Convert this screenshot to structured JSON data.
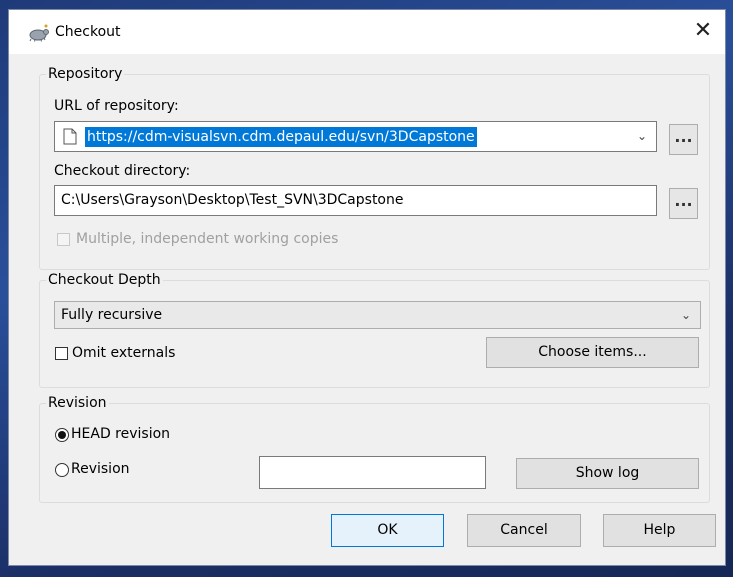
{
  "window": {
    "title": "Checkout",
    "close_glyph": "✕"
  },
  "repository": {
    "legend": "Repository",
    "url_label": "URL of repository:",
    "url_value": "https://cdm-visualsvn.cdm.depaul.edu/svn/3DCapstone",
    "browse_label": "...",
    "dir_label": "Checkout directory:",
    "dir_value": "C:\\Users\\Grayson\\Desktop\\Test_SVN\\3DCapstone",
    "multiple_label": "Multiple, independent working copies",
    "multiple_checked": false,
    "multiple_enabled": false
  },
  "depth": {
    "legend": "Checkout Depth",
    "selected": "Fully recursive",
    "omit_label": "Omit externals",
    "omit_checked": false,
    "choose_items_label": "Choose items..."
  },
  "revision": {
    "legend": "Revision",
    "head_label": "HEAD revision",
    "revision_label": "Revision",
    "selected": "HEAD revision",
    "revision_value": "",
    "show_log_label": "Show log"
  },
  "buttons": {
    "ok": "OK",
    "cancel": "Cancel",
    "help": "Help"
  },
  "icons": {
    "app": "tortoise-icon",
    "dropdown": "chevron-down-icon",
    "document": "document-icon"
  },
  "colors": {
    "selection": "#0078d7",
    "dialog_bg": "#f0f0f0",
    "default_button_border": "#0078d7"
  }
}
